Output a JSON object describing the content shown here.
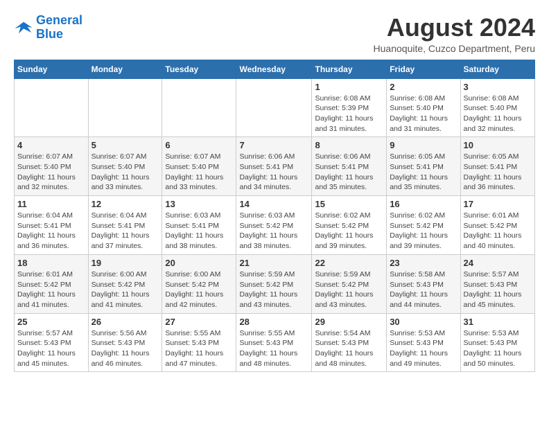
{
  "header": {
    "logo_line1": "General",
    "logo_line2": "Blue",
    "month": "August 2024",
    "location": "Huanoquite, Cuzco Department, Peru"
  },
  "days_of_week": [
    "Sunday",
    "Monday",
    "Tuesday",
    "Wednesday",
    "Thursday",
    "Friday",
    "Saturday"
  ],
  "weeks": [
    [
      {
        "day": "",
        "info": ""
      },
      {
        "day": "",
        "info": ""
      },
      {
        "day": "",
        "info": ""
      },
      {
        "day": "",
        "info": ""
      },
      {
        "day": "1",
        "info": "Sunrise: 6:08 AM\nSunset: 5:39 PM\nDaylight: 11 hours and 31 minutes."
      },
      {
        "day": "2",
        "info": "Sunrise: 6:08 AM\nSunset: 5:40 PM\nDaylight: 11 hours and 31 minutes."
      },
      {
        "day": "3",
        "info": "Sunrise: 6:08 AM\nSunset: 5:40 PM\nDaylight: 11 hours and 32 minutes."
      }
    ],
    [
      {
        "day": "4",
        "info": "Sunrise: 6:07 AM\nSunset: 5:40 PM\nDaylight: 11 hours and 32 minutes."
      },
      {
        "day": "5",
        "info": "Sunrise: 6:07 AM\nSunset: 5:40 PM\nDaylight: 11 hours and 33 minutes."
      },
      {
        "day": "6",
        "info": "Sunrise: 6:07 AM\nSunset: 5:40 PM\nDaylight: 11 hours and 33 minutes."
      },
      {
        "day": "7",
        "info": "Sunrise: 6:06 AM\nSunset: 5:41 PM\nDaylight: 11 hours and 34 minutes."
      },
      {
        "day": "8",
        "info": "Sunrise: 6:06 AM\nSunset: 5:41 PM\nDaylight: 11 hours and 35 minutes."
      },
      {
        "day": "9",
        "info": "Sunrise: 6:05 AM\nSunset: 5:41 PM\nDaylight: 11 hours and 35 minutes."
      },
      {
        "day": "10",
        "info": "Sunrise: 6:05 AM\nSunset: 5:41 PM\nDaylight: 11 hours and 36 minutes."
      }
    ],
    [
      {
        "day": "11",
        "info": "Sunrise: 6:04 AM\nSunset: 5:41 PM\nDaylight: 11 hours and 36 minutes."
      },
      {
        "day": "12",
        "info": "Sunrise: 6:04 AM\nSunset: 5:41 PM\nDaylight: 11 hours and 37 minutes."
      },
      {
        "day": "13",
        "info": "Sunrise: 6:03 AM\nSunset: 5:41 PM\nDaylight: 11 hours and 38 minutes."
      },
      {
        "day": "14",
        "info": "Sunrise: 6:03 AM\nSunset: 5:42 PM\nDaylight: 11 hours and 38 minutes."
      },
      {
        "day": "15",
        "info": "Sunrise: 6:02 AM\nSunset: 5:42 PM\nDaylight: 11 hours and 39 minutes."
      },
      {
        "day": "16",
        "info": "Sunrise: 6:02 AM\nSunset: 5:42 PM\nDaylight: 11 hours and 39 minutes."
      },
      {
        "day": "17",
        "info": "Sunrise: 6:01 AM\nSunset: 5:42 PM\nDaylight: 11 hours and 40 minutes."
      }
    ],
    [
      {
        "day": "18",
        "info": "Sunrise: 6:01 AM\nSunset: 5:42 PM\nDaylight: 11 hours and 41 minutes."
      },
      {
        "day": "19",
        "info": "Sunrise: 6:00 AM\nSunset: 5:42 PM\nDaylight: 11 hours and 41 minutes."
      },
      {
        "day": "20",
        "info": "Sunrise: 6:00 AM\nSunset: 5:42 PM\nDaylight: 11 hours and 42 minutes."
      },
      {
        "day": "21",
        "info": "Sunrise: 5:59 AM\nSunset: 5:42 PM\nDaylight: 11 hours and 43 minutes."
      },
      {
        "day": "22",
        "info": "Sunrise: 5:59 AM\nSunset: 5:42 PM\nDaylight: 11 hours and 43 minutes."
      },
      {
        "day": "23",
        "info": "Sunrise: 5:58 AM\nSunset: 5:43 PM\nDaylight: 11 hours and 44 minutes."
      },
      {
        "day": "24",
        "info": "Sunrise: 5:57 AM\nSunset: 5:43 PM\nDaylight: 11 hours and 45 minutes."
      }
    ],
    [
      {
        "day": "25",
        "info": "Sunrise: 5:57 AM\nSunset: 5:43 PM\nDaylight: 11 hours and 45 minutes."
      },
      {
        "day": "26",
        "info": "Sunrise: 5:56 AM\nSunset: 5:43 PM\nDaylight: 11 hours and 46 minutes."
      },
      {
        "day": "27",
        "info": "Sunrise: 5:55 AM\nSunset: 5:43 PM\nDaylight: 11 hours and 47 minutes."
      },
      {
        "day": "28",
        "info": "Sunrise: 5:55 AM\nSunset: 5:43 PM\nDaylight: 11 hours and 48 minutes."
      },
      {
        "day": "29",
        "info": "Sunrise: 5:54 AM\nSunset: 5:43 PM\nDaylight: 11 hours and 48 minutes."
      },
      {
        "day": "30",
        "info": "Sunrise: 5:53 AM\nSunset: 5:43 PM\nDaylight: 11 hours and 49 minutes."
      },
      {
        "day": "31",
        "info": "Sunrise: 5:53 AM\nSunset: 5:43 PM\nDaylight: 11 hours and 50 minutes."
      }
    ]
  ]
}
